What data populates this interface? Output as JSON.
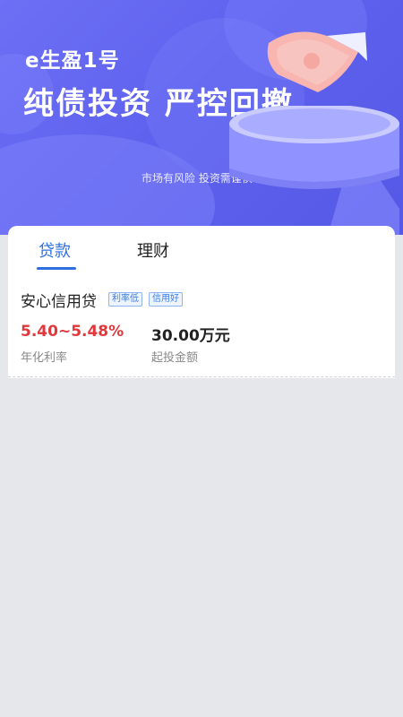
{
  "banner": {
    "brand": "e生盈1号",
    "headline": "纯债投资 严控回撤",
    "risk_notice": "市场有风险 投资需谨慎",
    "colors": {
      "background": "#5f62ee",
      "text": "#ffffff"
    },
    "icons": [
      "money-bill-icon",
      "podium-icon"
    ]
  },
  "tabs": [
    {
      "label": "贷款",
      "active": true
    },
    {
      "label": "理财",
      "active": false
    }
  ],
  "product": {
    "name": "安心信用贷",
    "tags": [
      "利率低",
      "信用好"
    ],
    "rate": "5.40~5.48%",
    "rate_label": "年化利率",
    "amount": "30.00万元",
    "amount_label": "起投金额"
  },
  "colors": {
    "accent": "#2e6fe0",
    "rate": "#e0383a",
    "page_background": "#e6e7ea"
  }
}
